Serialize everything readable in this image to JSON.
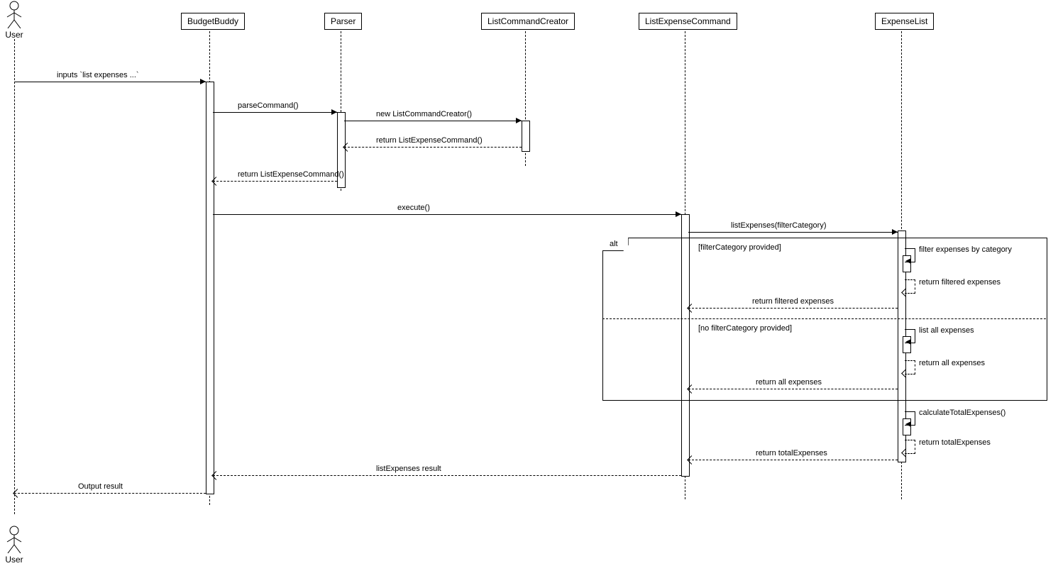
{
  "participants": {
    "user_top": "User",
    "budgetbuddy": "BudgetBuddy",
    "parser": "Parser",
    "listcommandcreator": "ListCommandCreator",
    "listexpensecommand": "ListExpenseCommand",
    "expenselist": "ExpenseList",
    "user_bottom": "User"
  },
  "messages": {
    "m1": "inputs `list expenses ...`",
    "m2": "parseCommand()",
    "m3": "new ListCommandCreator()",
    "m4": "return ListExpenseCommand()",
    "m5": "return ListExpenseCommand()",
    "m6": "execute()",
    "m7": "listExpenses(filterCategory)",
    "m8": "filter expenses by category",
    "m9": "return filtered expenses",
    "m10": "return filtered expenses",
    "m11": "list all expenses",
    "m12": "return all expenses",
    "m13": "return all expenses",
    "m14": "calculateTotalExpenses()",
    "m15": "return totalExpenses",
    "m16": "return totalExpenses",
    "m17": "listExpenses result",
    "m18": "Output result"
  },
  "fragment": {
    "label": "alt",
    "guard1": "[filterCategory provided]",
    "guard2": "[no filterCategory provided]"
  },
  "chart_data": {
    "type": "sequence-diagram",
    "participants": [
      "User",
      "BudgetBuddy",
      "Parser",
      "ListCommandCreator",
      "ListExpenseCommand",
      "ExpenseList"
    ],
    "interactions": [
      {
        "from": "User",
        "to": "BudgetBuddy",
        "label": "inputs `list expenses ...`",
        "kind": "sync"
      },
      {
        "from": "BudgetBuddy",
        "to": "Parser",
        "label": "parseCommand()",
        "kind": "sync"
      },
      {
        "from": "Parser",
        "to": "ListCommandCreator",
        "label": "new ListCommandCreator()",
        "kind": "sync"
      },
      {
        "from": "ListCommandCreator",
        "to": "Parser",
        "label": "return ListExpenseCommand()",
        "kind": "return"
      },
      {
        "from": "Parser",
        "to": "BudgetBuddy",
        "label": "return ListExpenseCommand()",
        "kind": "return"
      },
      {
        "from": "BudgetBuddy",
        "to": "ListExpenseCommand",
        "label": "execute()",
        "kind": "sync"
      },
      {
        "from": "ListExpenseCommand",
        "to": "ExpenseList",
        "label": "listExpenses(filterCategory)",
        "kind": "sync"
      },
      {
        "fragment": "alt",
        "guards": [
          "[filterCategory provided]",
          "[no filterCategory provided]"
        ],
        "regions": [
          [
            {
              "from": "ExpenseList",
              "to": "ExpenseList",
              "label": "filter expenses by category",
              "kind": "self"
            },
            {
              "from": "ExpenseList",
              "to": "ExpenseList",
              "label": "return filtered expenses",
              "kind": "self-return"
            },
            {
              "from": "ExpenseList",
              "to": "ListExpenseCommand",
              "label": "return filtered expenses",
              "kind": "return"
            }
          ],
          [
            {
              "from": "ExpenseList",
              "to": "ExpenseList",
              "label": "list all expenses",
              "kind": "self"
            },
            {
              "from": "ExpenseList",
              "to": "ExpenseList",
              "label": "return all expenses",
              "kind": "self-return"
            },
            {
              "from": "ExpenseList",
              "to": "ListExpenseCommand",
              "label": "return all expenses",
              "kind": "return"
            }
          ]
        ]
      },
      {
        "from": "ExpenseList",
        "to": "ExpenseList",
        "label": "calculateTotalExpenses()",
        "kind": "self"
      },
      {
        "from": "ExpenseList",
        "to": "ExpenseList",
        "label": "return totalExpenses",
        "kind": "self-return"
      },
      {
        "from": "ExpenseList",
        "to": "ListExpenseCommand",
        "label": "return totalExpenses",
        "kind": "return"
      },
      {
        "from": "ListExpenseCommand",
        "to": "BudgetBuddy",
        "label": "listExpenses result",
        "kind": "return"
      },
      {
        "from": "BudgetBuddy",
        "to": "User",
        "label": "Output result",
        "kind": "return"
      }
    ]
  }
}
